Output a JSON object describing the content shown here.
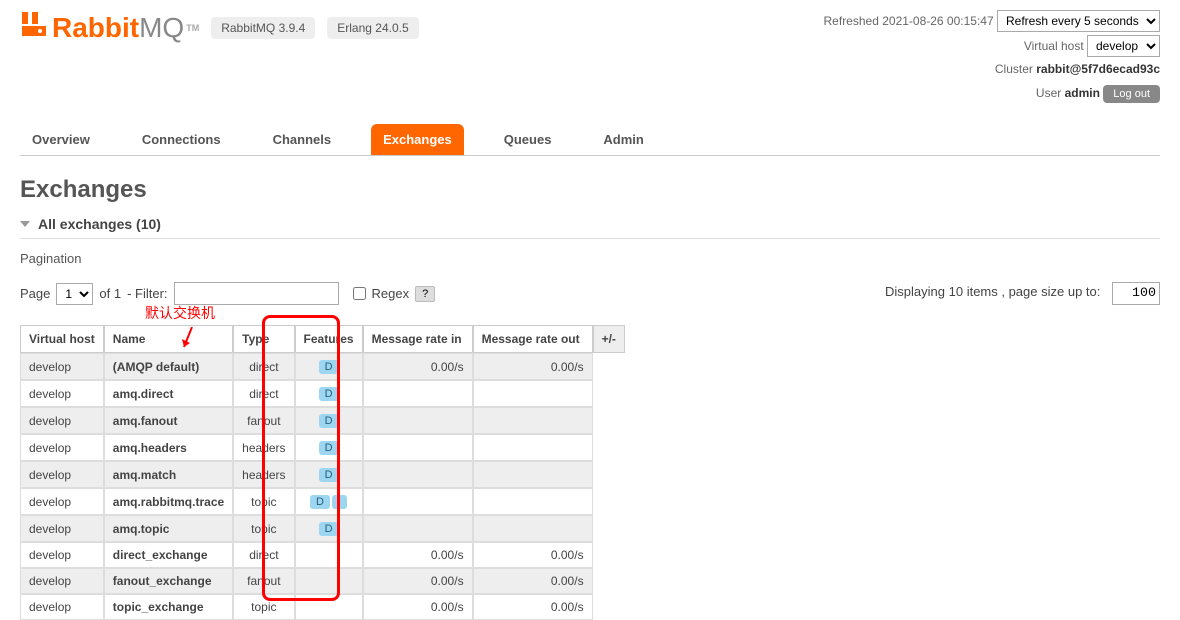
{
  "header": {
    "logo_text_rabbit": "Rabbit",
    "logo_text_mq": "MQ",
    "logo_tm": "TM",
    "version_rabbitmq": "RabbitMQ 3.9.4",
    "version_erlang": "Erlang 24.0.5",
    "refreshed_label": "Refreshed 2021-08-26 00:15:47",
    "refresh_select": "Refresh every 5 seconds",
    "vhost_label": "Virtual host",
    "vhost_select": "develop",
    "cluster_label": "Cluster",
    "cluster_name": "rabbit@5f7d6ecad93c",
    "user_label": "User",
    "user_name": "admin",
    "logout_label": "Log out"
  },
  "tabs": [
    {
      "label": "Overview",
      "active": false
    },
    {
      "label": "Connections",
      "active": false
    },
    {
      "label": "Channels",
      "active": false
    },
    {
      "label": "Exchanges",
      "active": true
    },
    {
      "label": "Queues",
      "active": false
    },
    {
      "label": "Admin",
      "active": false
    }
  ],
  "main": {
    "title": "Exchanges",
    "section_title": "All exchanges (10)",
    "pagination_label": "Pagination",
    "page_label": "Page",
    "page_select": "1",
    "of_label": "of 1",
    "filter_label": "- Filter:",
    "regex_label": "Regex",
    "help_label": "?",
    "displaying_label": "Displaying 10 items , page size up to:",
    "page_size": "100",
    "plus_minus": "+/-",
    "annotation_text": "默认交换机"
  },
  "table": {
    "headers": [
      "Virtual host",
      "Name",
      "Type",
      "Features",
      "Message rate in",
      "Message rate out"
    ],
    "rows": [
      {
        "vhost": "develop",
        "name": "(AMQP default)",
        "type": "direct",
        "features": [
          "D"
        ],
        "rate_in": "0.00/s",
        "rate_out": "0.00/s"
      },
      {
        "vhost": "develop",
        "name": "amq.direct",
        "type": "direct",
        "features": [
          "D"
        ],
        "rate_in": "",
        "rate_out": ""
      },
      {
        "vhost": "develop",
        "name": "amq.fanout",
        "type": "fanout",
        "features": [
          "D"
        ],
        "rate_in": "",
        "rate_out": ""
      },
      {
        "vhost": "develop",
        "name": "amq.headers",
        "type": "headers",
        "features": [
          "D"
        ],
        "rate_in": "",
        "rate_out": ""
      },
      {
        "vhost": "develop",
        "name": "amq.match",
        "type": "headers",
        "features": [
          "D"
        ],
        "rate_in": "",
        "rate_out": ""
      },
      {
        "vhost": "develop",
        "name": "amq.rabbitmq.trace",
        "type": "topic",
        "features": [
          "D",
          "I"
        ],
        "rate_in": "",
        "rate_out": ""
      },
      {
        "vhost": "develop",
        "name": "amq.topic",
        "type": "topic",
        "features": [
          "D"
        ],
        "rate_in": "",
        "rate_out": ""
      },
      {
        "vhost": "develop",
        "name": "direct_exchange",
        "type": "direct",
        "features": [],
        "rate_in": "0.00/s",
        "rate_out": "0.00/s"
      },
      {
        "vhost": "develop",
        "name": "fanout_exchange",
        "type": "fanout",
        "features": [],
        "rate_in": "0.00/s",
        "rate_out": "0.00/s"
      },
      {
        "vhost": "develop",
        "name": "topic_exchange",
        "type": "topic",
        "features": [],
        "rate_in": "0.00/s",
        "rate_out": "0.00/s"
      }
    ]
  }
}
